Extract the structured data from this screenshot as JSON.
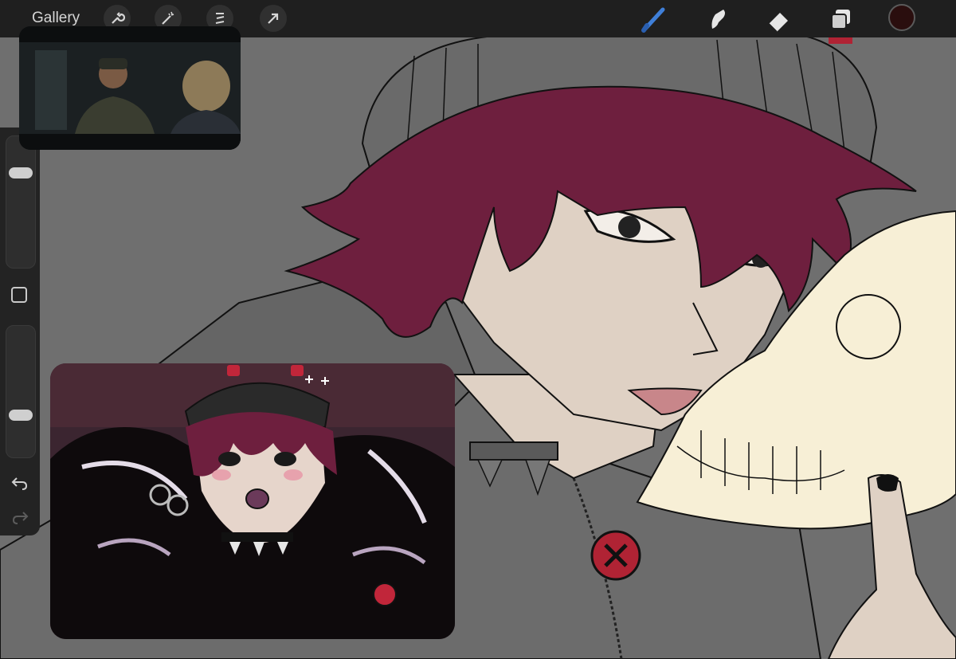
{
  "toolbar": {
    "gallery_label": "Gallery",
    "actions": [
      {
        "name": "wrench-icon"
      },
      {
        "name": "magic-wand-icon"
      },
      {
        "name": "selection-icon"
      },
      {
        "name": "transform-arrow-icon"
      }
    ],
    "tools": [
      {
        "name": "brush-icon",
        "active": true
      },
      {
        "name": "smudge-icon",
        "active": false
      },
      {
        "name": "eraser-icon",
        "active": false
      },
      {
        "name": "layers-icon",
        "active": false
      }
    ],
    "current_color": "#2a0e0e",
    "active_tool_color": "#3f7fd8"
  },
  "sidebar": {
    "brush_size_level": 0.75,
    "opacity_level": 0.3,
    "undo_icon": "undo-icon",
    "redo_icon": "redo-icon",
    "modify_icon": "square-modify-icon"
  },
  "palette": {
    "hair": "#6e1f3e",
    "skin": "#dfd1c4",
    "skull": "#f7efd6",
    "hoodie": "#6c6c6c",
    "lineart": "#111111",
    "badge": "#b02334"
  }
}
